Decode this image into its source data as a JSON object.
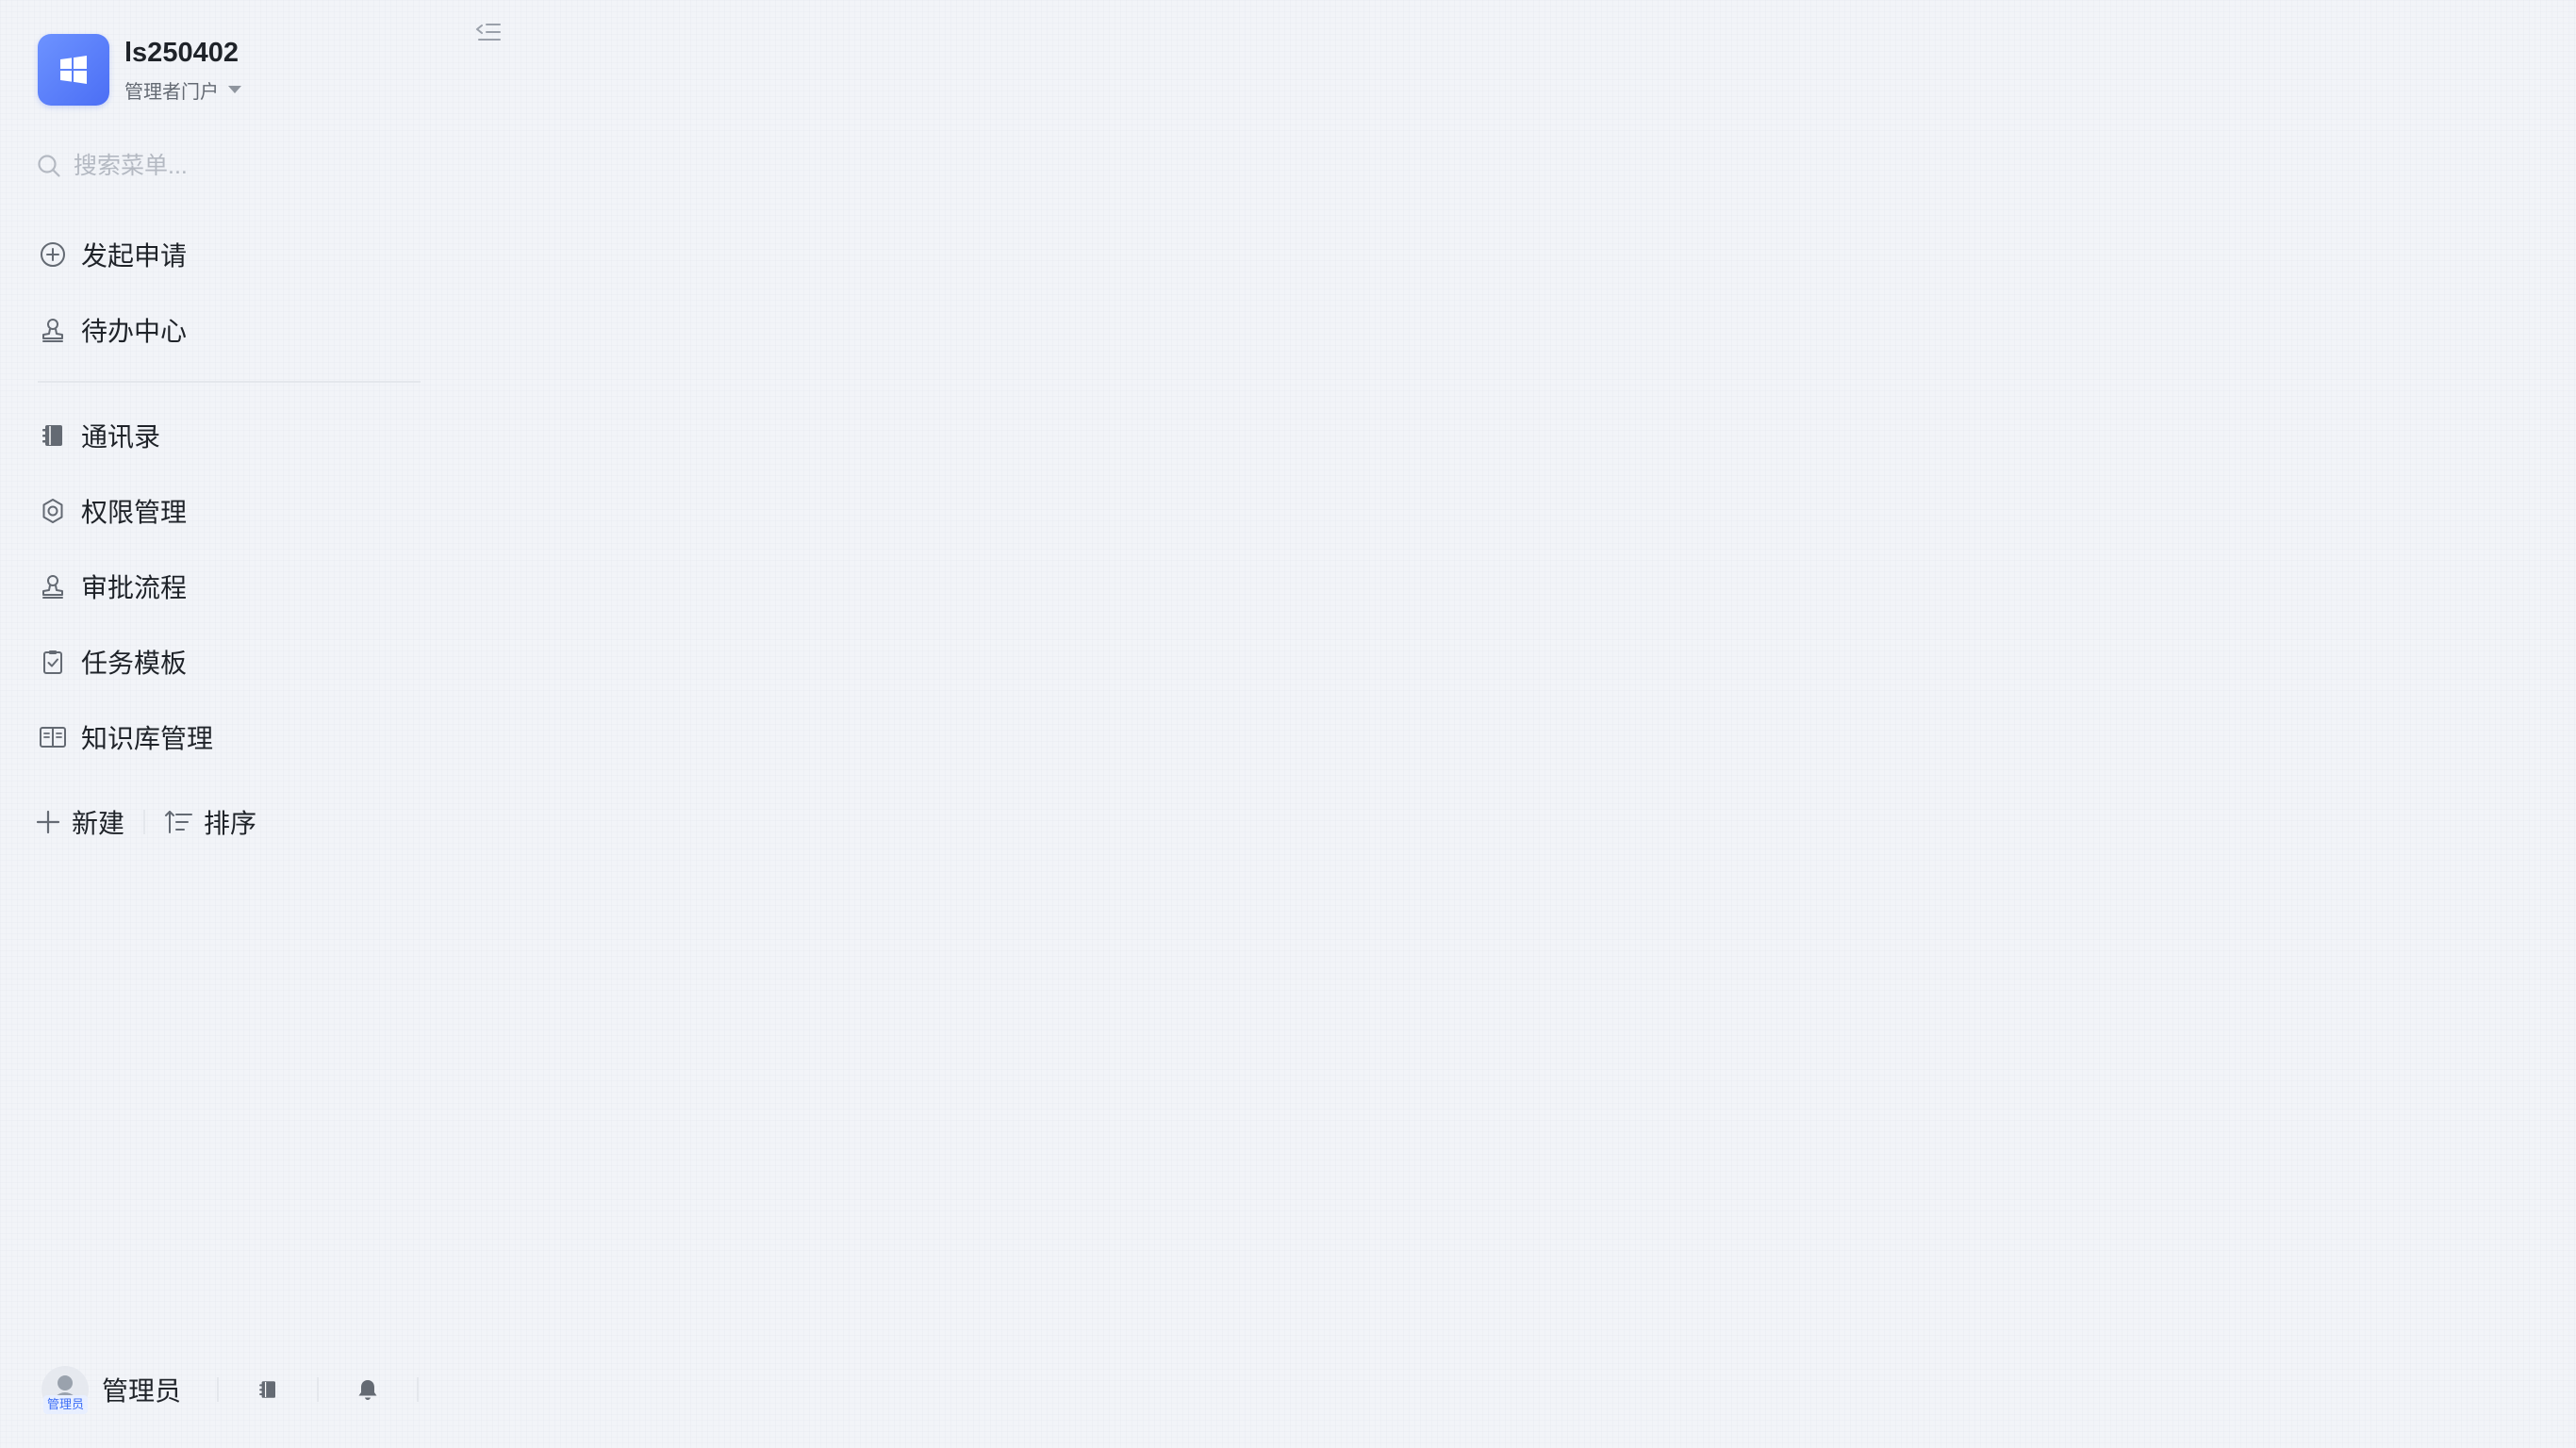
{
  "app": {
    "name": "ls250402",
    "portal": "管理者门户",
    "logo_icon": "windows-grid-icon",
    "accent_color": "#4b6ef5"
  },
  "search": {
    "placeholder": "搜索菜单..."
  },
  "menu": {
    "primary": [
      {
        "label": "发起申请",
        "icon": "plus-circle-icon"
      },
      {
        "label": "待办中心",
        "icon": "user-stamp-icon"
      }
    ],
    "admin": [
      {
        "label": "通讯录",
        "icon": "address-book-icon"
      },
      {
        "label": "权限管理",
        "icon": "gear-icon"
      },
      {
        "label": "审批流程",
        "icon": "user-stamp-icon"
      },
      {
        "label": "任务模板",
        "icon": "checklist-icon"
      },
      {
        "label": "知识库管理",
        "icon": "open-book-icon"
      }
    ]
  },
  "actions": {
    "new_label": "新建",
    "sort_label": "排序"
  },
  "footer": {
    "user_name": "管理员",
    "badge": "管理员"
  }
}
